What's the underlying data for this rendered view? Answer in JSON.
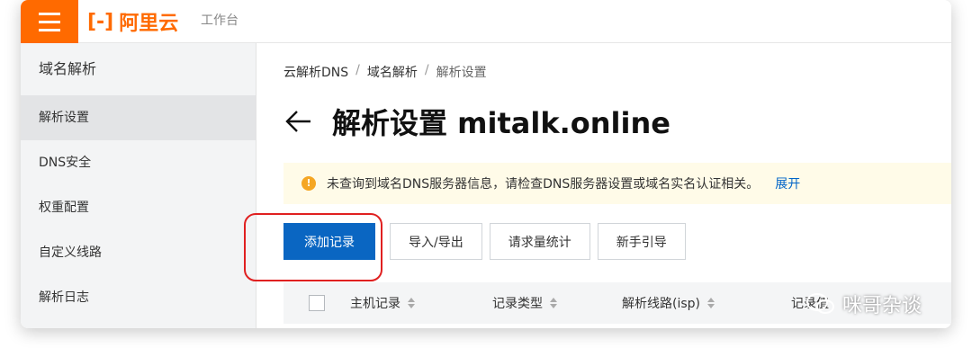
{
  "topbar": {
    "brand": "阿里云",
    "sub": "工作台"
  },
  "sidebar": {
    "title": "域名解析",
    "items": [
      {
        "label": "解析设置",
        "active": true
      },
      {
        "label": "DNS安全"
      },
      {
        "label": "权重配置"
      },
      {
        "label": "自定义线路"
      },
      {
        "label": "解析日志"
      }
    ]
  },
  "breadcrumb": {
    "items": [
      "云解析DNS",
      "域名解析",
      "解析设置"
    ],
    "separator": "/"
  },
  "page": {
    "title": "解析设置 mitalk.online"
  },
  "alert": {
    "text": "未查询到域名DNS服务器信息，请检查DNS服务器设置或域名实名认证相关。",
    "link": "展开"
  },
  "toolbar": {
    "add_record": "添加记录",
    "import_export": "导入/导出",
    "request_stats": "请求量统计",
    "guide": "新手引导"
  },
  "table": {
    "columns": [
      "主机记录",
      "记录类型",
      "解析线路(isp)",
      "记录值"
    ]
  },
  "watermark": {
    "text": "咪哥杂谈"
  },
  "colors": {
    "accent": "#ff6a00",
    "primary": "#0a66c2",
    "link": "#0064c8",
    "highlight": "#e02020"
  }
}
